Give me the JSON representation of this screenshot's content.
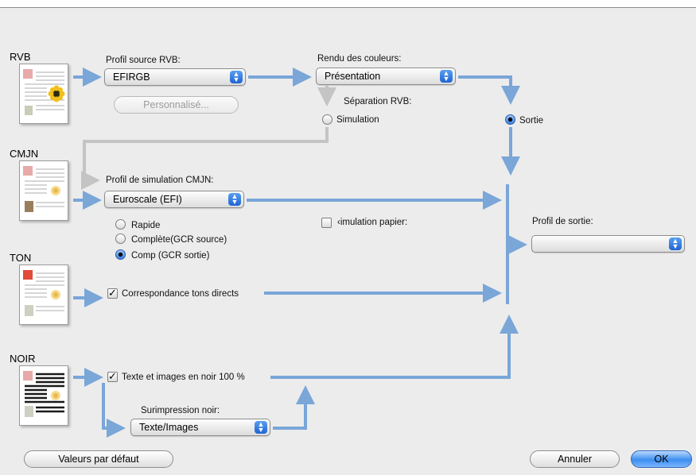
{
  "sections": {
    "rvb": "RVB",
    "cmjn": "CMJN",
    "ton": "TON",
    "noir": "NOIR"
  },
  "rvb": {
    "source_label": "Profil source RVB:",
    "source_value": "EFIRGB",
    "custom_button": "Personnalisé...",
    "rendering_label": "Rendu des couleurs:",
    "rendering_value": "Présentation",
    "separation_label": "Séparation RVB:",
    "simulation_option": "Simulation",
    "sortie_option": "Sortie"
  },
  "cmjn": {
    "simulation_label": "Profil de simulation CMJN:",
    "simulation_value": "Euroscale (EFI)",
    "paper_simulation": "‹imulation papier:",
    "mode_rapide": "Rapide",
    "mode_complete_source": "Complète(GCR source)",
    "mode_comp_sortie": "Comp (GCR sortie)"
  },
  "output": {
    "profile_label": "Profil de sortie:",
    "profile_value": ""
  },
  "ton": {
    "spot_match": "Correspondance tons directs"
  },
  "noir": {
    "black_text": "Texte et images en noir 100 %",
    "overprint_label": "Surimpression noir:",
    "overprint_value": "Texte/Images"
  },
  "buttons": {
    "defaults": "Valeurs par défaut",
    "cancel": "Annuler",
    "ok": "OK"
  },
  "state": {
    "separation_selected": "Sortie",
    "cmjn_mode_selected": "Comp (GCR sortie)",
    "paper_simulation_checked": false,
    "spot_match_checked": true,
    "black_text_checked": true
  },
  "colors": {
    "flow_arrow": "#7aa6d8",
    "flow_arrow_inactive": "#c4c4c4",
    "accent": "#3d8ef0",
    "panel": "#ececec"
  }
}
